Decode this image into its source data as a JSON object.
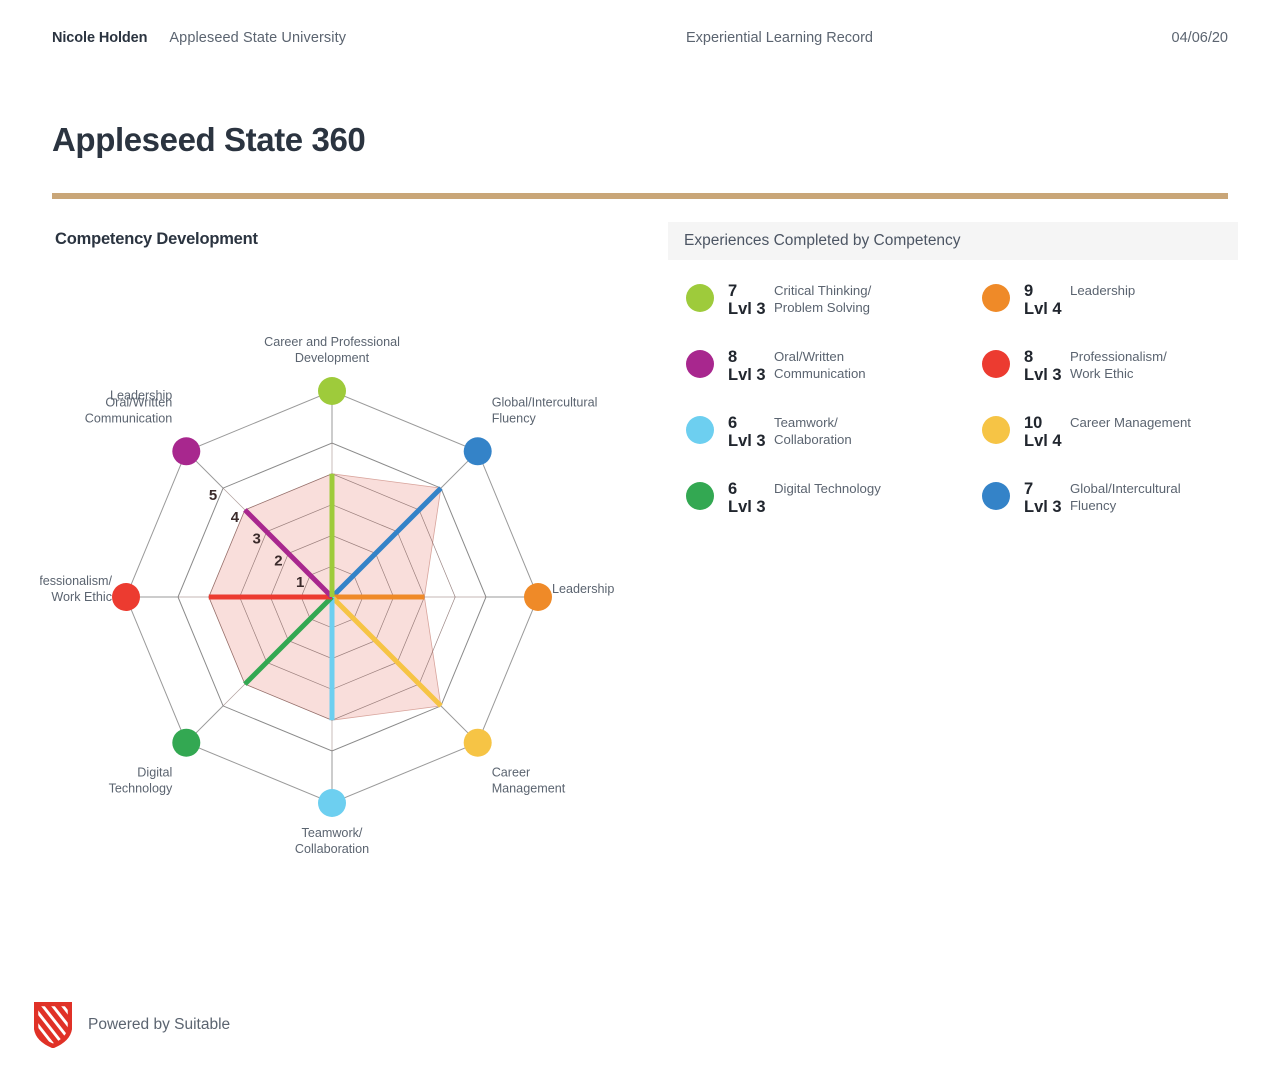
{
  "header": {
    "name": "Nicole Holden",
    "organization": "Appleseed State University",
    "record_title": "Experiential Learning Record",
    "date": "04/06/20"
  },
  "title": "Appleseed State 360",
  "rule_color": "#c9a678",
  "sections": {
    "competency_development": "Competency Development",
    "experiences_panel": "Experiences Completed by Competency"
  },
  "legend": {
    "items": [
      {
        "count": "7",
        "level": "Lvl 3",
        "label": "Critical Thinking/\nProblem Solving",
        "color": "#9ecb3b"
      },
      {
        "count": "9",
        "level": "Lvl 4",
        "label": "Leadership",
        "color": "#ef8a28"
      },
      {
        "count": "8",
        "level": "Lvl 3",
        "label": "Oral/Written\nCommunication",
        "color": "#a8278e"
      },
      {
        "count": "8",
        "level": "Lvl 3",
        "label": "Professionalism/\nWork Ethic",
        "color": "#ec3b30"
      },
      {
        "count": "6",
        "level": "Lvl 3",
        "label": "Teamwork/\nCollaboration",
        "color": "#6dcff0"
      },
      {
        "count": "10",
        "level": "Lvl 4",
        "label": "Career Management",
        "color": "#f6c445"
      },
      {
        "count": "6",
        "level": "Lvl 3",
        "label": "Digital Technology",
        "color": "#33a852"
      },
      {
        "count": "7",
        "level": "Lvl 3",
        "label": "Global/Intercultural\nFluency",
        "color": "#3483c8"
      }
    ]
  },
  "chart_data": {
    "type": "radar",
    "title": "Competency Development",
    "scale_min": 0,
    "scale_max": 5,
    "tick_labels": [
      "1",
      "2",
      "3",
      "4",
      "5"
    ],
    "grid": true,
    "fill_color": "#f9dedb",
    "grid_color": "#8a8a8a",
    "axes": [
      {
        "label": "Global/Intercultural\nFluency",
        "value": 5,
        "color": "#3483c8",
        "angle_deg": -45
      },
      {
        "label": "Leadership",
        "value": 3,
        "color": "#ef8a28",
        "angle_deg": 0
      },
      {
        "label": "Career\nManagement",
        "value": 5,
        "color": "#f6c445",
        "angle_deg": 45
      },
      {
        "label": "Teamwork/\nCollaboration",
        "value": 4,
        "color": "#6dcff0",
        "angle_deg": 90
      },
      {
        "label": "Digital\nTechnology",
        "value": 4,
        "color": "#33a852",
        "angle_deg": 135
      },
      {
        "label": "Professionalism/\nWork Ethic",
        "value": 4,
        "color": "#ec3b30",
        "angle_deg": 180
      },
      {
        "label": "Oral/Written\nCommunication",
        "value": 4,
        "color": "#a8278e",
        "angle_deg": -135
      },
      {
        "label": "Career and Professional\nDevelopment",
        "value": 4,
        "color": "#9ecb3b",
        "angle_deg": -90
      }
    ],
    "extra_axis_label": "Leadership"
  },
  "footer": {
    "text": "Powered by Suitable",
    "logo_color": "#e03127"
  }
}
